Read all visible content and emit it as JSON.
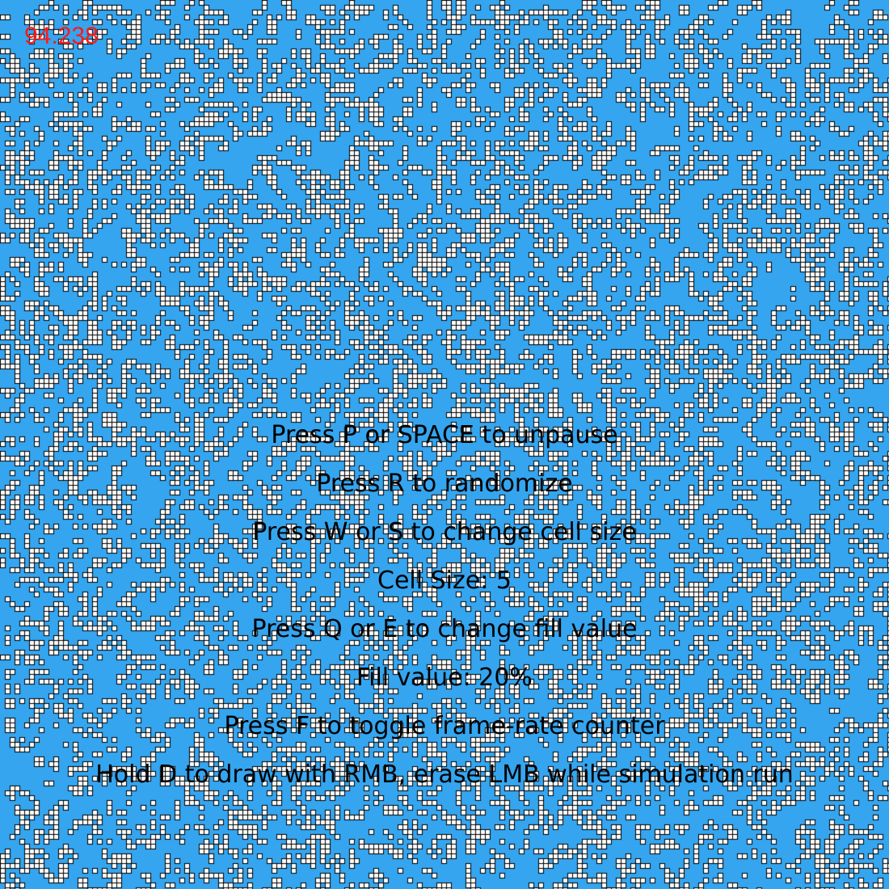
{
  "game": {
    "background_color": "#35a5ef",
    "cell_color": "#ffffff",
    "cell_border_color": "#000000",
    "text_color": "#000000",
    "fps_color": "#ff1a1a",
    "cell_size": 5,
    "fill_value_percent": 20,
    "paused": true
  },
  "fps_counter": "94.238",
  "instructions": {
    "unpause": "Press P or SPACE to unpause",
    "randomize": "Press R to randomize",
    "cell_size_hint": "Press W or S to change cell size",
    "cell_size": "Cell Size: 5",
    "fill_hint": "Press Q or E to change fill value",
    "fill_value": "Fill value: 20%",
    "fps_hint": "Press F to toggle frame-rate counter",
    "draw_hint": "Hold D to draw with RMB, erase LMB while simulation run"
  }
}
